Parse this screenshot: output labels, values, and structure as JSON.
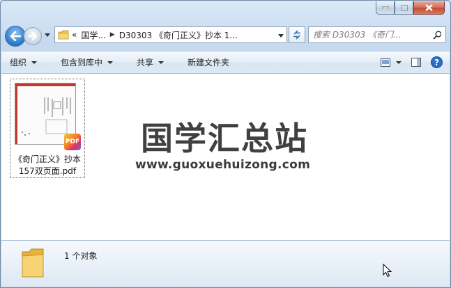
{
  "window": {
    "caption_buttons": [
      "minimize-icon",
      "maximize-icon",
      "close-icon"
    ]
  },
  "nav": {
    "address": {
      "overflow": "«",
      "crumbs": [
        "国学...",
        "D30303 《奇门正义》抄本 1..."
      ]
    },
    "search_placeholder": "搜索 D30303 《奇门..."
  },
  "toolbar": {
    "organize": "组织",
    "include_in_library": "包含到库中",
    "share": "共享",
    "new_folder": "新建文件夹"
  },
  "files": [
    {
      "name": "《奇门正义》抄本157双页面.pdf",
      "name_line1": "《奇门正义》抄本",
      "name_line2": "157双页面.pdf",
      "type_badge": "PDF"
    }
  ],
  "watermark": {
    "title": "国学汇总站",
    "url": "www.guoxuehuizong.com"
  },
  "status": {
    "item_count": "1 个对象"
  },
  "colors": {
    "accent": "#2a78c8",
    "close_button": "#c14a30",
    "folder": "#f2c24f"
  }
}
